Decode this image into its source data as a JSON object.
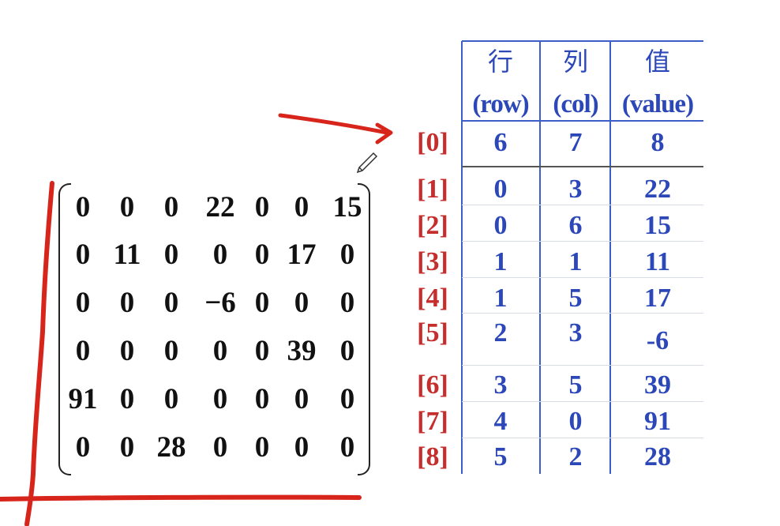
{
  "matrix": {
    "rows": [
      [
        "0",
        "0",
        "0",
        "22",
        "0",
        "0",
        "15"
      ],
      [
        "0",
        "11",
        "0",
        "0",
        "0",
        "17",
        "0"
      ],
      [
        "0",
        "0",
        "0",
        "−6",
        "0",
        "0",
        "0"
      ],
      [
        "0",
        "0",
        "0",
        "0",
        "0",
        "39",
        "0"
      ],
      [
        "91",
        "0",
        "0",
        "0",
        "0",
        "0",
        "0"
      ],
      [
        "0",
        "0",
        "28",
        "0",
        "0",
        "0",
        "0"
      ]
    ]
  },
  "triplet": {
    "headers": [
      {
        "cn": "行",
        "en": "(row)"
      },
      {
        "cn": "列",
        "en": "(col)"
      },
      {
        "cn": "值",
        "en": "(value)"
      }
    ],
    "rows": [
      {
        "index": "[0]",
        "row": "6",
        "col": "7",
        "value": "8"
      },
      {
        "index": "[1]",
        "row": "0",
        "col": "3",
        "value": "22"
      },
      {
        "index": "[2]",
        "row": "0",
        "col": "6",
        "value": "15"
      },
      {
        "index": "[3]",
        "row": "1",
        "col": "1",
        "value": "11"
      },
      {
        "index": "[4]",
        "row": "1",
        "col": "5",
        "value": "17"
      },
      {
        "index": "[5]",
        "row": "2",
        "col": "3",
        "value": "-6"
      },
      {
        "index": "[6]",
        "row": "3",
        "col": "5",
        "value": "39"
      },
      {
        "index": "[7]",
        "row": "4",
        "col": "0",
        "value": "91"
      },
      {
        "index": "[8]",
        "row": "5",
        "col": "2",
        "value": "28"
      }
    ]
  },
  "colors": {
    "header_blue": "#2b47b8",
    "index_red": "#c62d2d",
    "annotation_red": "#d8251c",
    "matrix_text": "#111111"
  },
  "icons": [
    "pencil-cursor-icon"
  ]
}
